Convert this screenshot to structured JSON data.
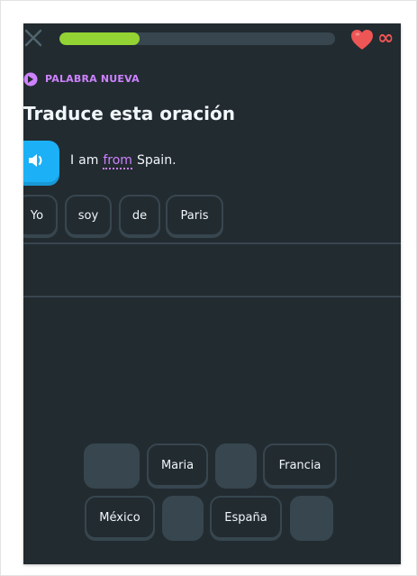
{
  "header": {
    "close_icon": "close-icon",
    "progress_fraction": 0.29,
    "progress_color": "#93d333",
    "heart_icon": "heart-icon",
    "hearts_count": "∞"
  },
  "badge": {
    "icon": "new-word-icon",
    "label": "PALABRA NUEVA",
    "color": "#ce82ff"
  },
  "title": "Traduce esta oración",
  "prompt": {
    "speaker_icon": "speaker-icon",
    "words": [
      "I",
      "am",
      "from",
      "Spain."
    ],
    "hint_word": "from"
  },
  "answer_chips": [
    "Yo",
    "soy",
    "de",
    "Paris"
  ],
  "word_bank": {
    "row1": [
      "",
      "Maria",
      "",
      "Francia"
    ],
    "row2": [
      "México",
      "",
      "España",
      ""
    ]
  },
  "colors": {
    "background": "#222b30",
    "border": "#37464f",
    "speaker": "#1cb0f6",
    "heart": "#ee5555"
  }
}
